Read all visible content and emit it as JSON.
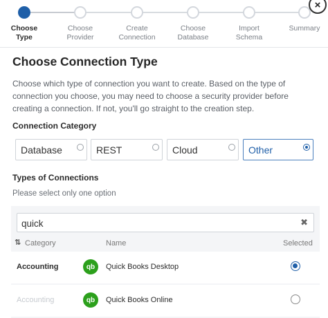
{
  "stepper": {
    "steps": [
      {
        "label": "Choose\nType",
        "active": true
      },
      {
        "label": "Choose\nProvider",
        "active": false
      },
      {
        "label": "Create\nConnection",
        "active": false
      },
      {
        "label": "Choose\nDatabase",
        "active": false
      },
      {
        "label": "Import\nSchema",
        "active": false
      },
      {
        "label": "Summary",
        "active": false
      }
    ],
    "close_icon": "close-icon"
  },
  "page": {
    "title": "Choose Connection Type",
    "description": "Choose which type of connection you want to create. Based on the type of connection you choose, you may need to choose a security provider before creating a connection. If not, you'll go straight to the creation step."
  },
  "connection_category": {
    "label": "Connection Category",
    "options": [
      {
        "label": "Database",
        "selected": false
      },
      {
        "label": "REST",
        "selected": false
      },
      {
        "label": "Cloud",
        "selected": false
      },
      {
        "label": "Other",
        "selected": true
      }
    ]
  },
  "types": {
    "label": "Types of Connections",
    "hint": "Please select only one option",
    "search": {
      "value": "quick",
      "clear_icon": "close-icon"
    },
    "columns": {
      "category": "Category",
      "name": "Name",
      "selected": "Selected"
    },
    "rows": [
      {
        "category": "Accounting",
        "name": "Quick Books Desktop",
        "logo": "qb",
        "selected": true
      },
      {
        "category": "Accounting",
        "name": "Quick Books Online",
        "logo": "qb",
        "selected": false
      }
    ]
  },
  "colors": {
    "accent": "#1f5fa8",
    "qb_green": "#2ca01c",
    "panel_bg": "#f4f5f7"
  }
}
